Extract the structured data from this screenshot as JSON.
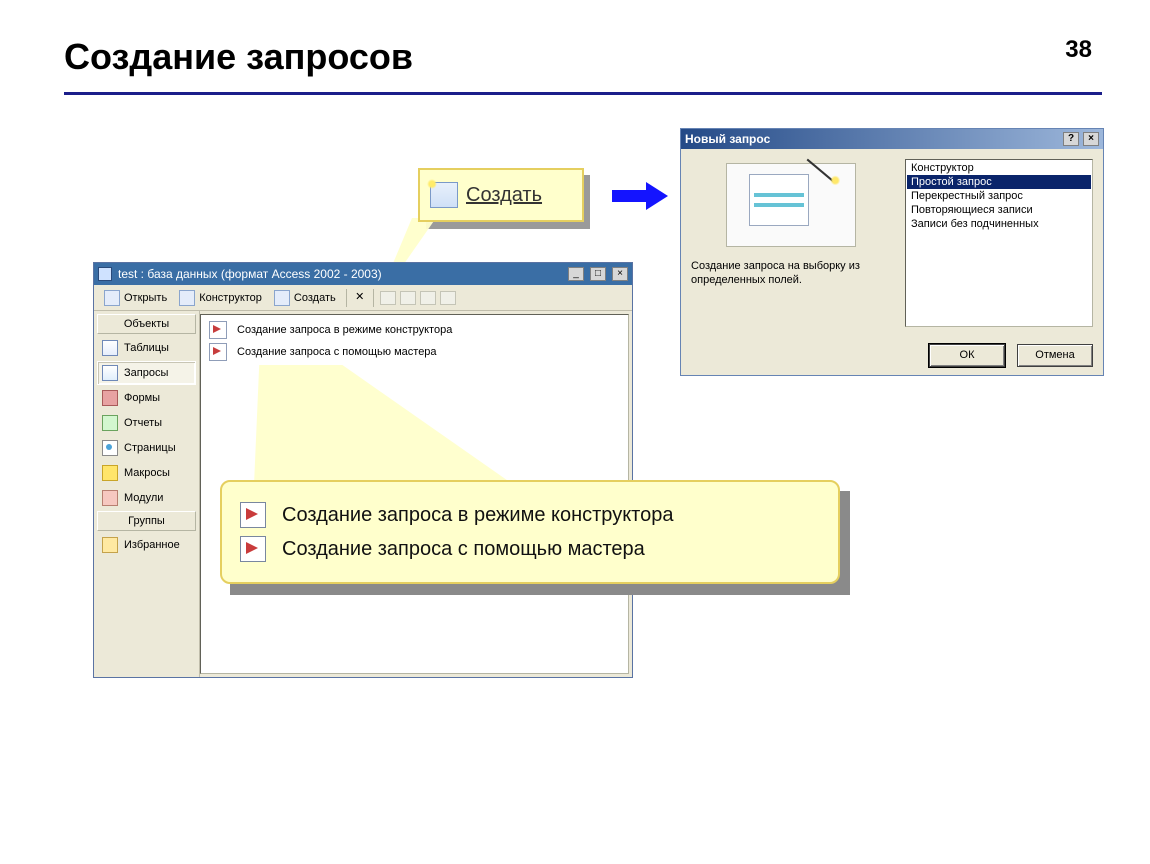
{
  "slide": {
    "title": "Создание запросов",
    "number": "38"
  },
  "create_button": {
    "label": "Создать"
  },
  "db_window": {
    "title": "test : база данных (формат Access 2002 - 2003)",
    "toolbar": {
      "open": "Открыть",
      "designer": "Конструктор",
      "create": "Создать"
    },
    "nav": {
      "objects_header": "Объекты",
      "groups_header": "Группы",
      "items": {
        "tables": "Таблицы",
        "queries": "Запросы",
        "forms": "Формы",
        "reports": "Отчеты",
        "pages": "Страницы",
        "macros": "Макросы",
        "modules": "Модули",
        "favorites": "Избранное"
      }
    },
    "content": {
      "row1": "Создание запроса в режиме конструктора",
      "row2": "Создание запроса с помощью мастера"
    }
  },
  "zoom": {
    "row1": "Создание запроса в режиме конструктора",
    "row2": "Создание запроса с помощью мастера"
  },
  "dialog": {
    "title": "Новый запрос",
    "desc": "Создание запроса на выборку из определенных полей.",
    "options": {
      "o1": "Конструктор",
      "o2": "Простой запрос",
      "o3": "Перекрестный запрос",
      "o4": "Повторяющиеся записи",
      "o5": "Записи без подчиненных"
    },
    "buttons": {
      "ok": "ОК",
      "cancel": "Отмена"
    }
  },
  "win_controls": {
    "help": "?",
    "min": "_",
    "max": "□",
    "close": "×"
  }
}
